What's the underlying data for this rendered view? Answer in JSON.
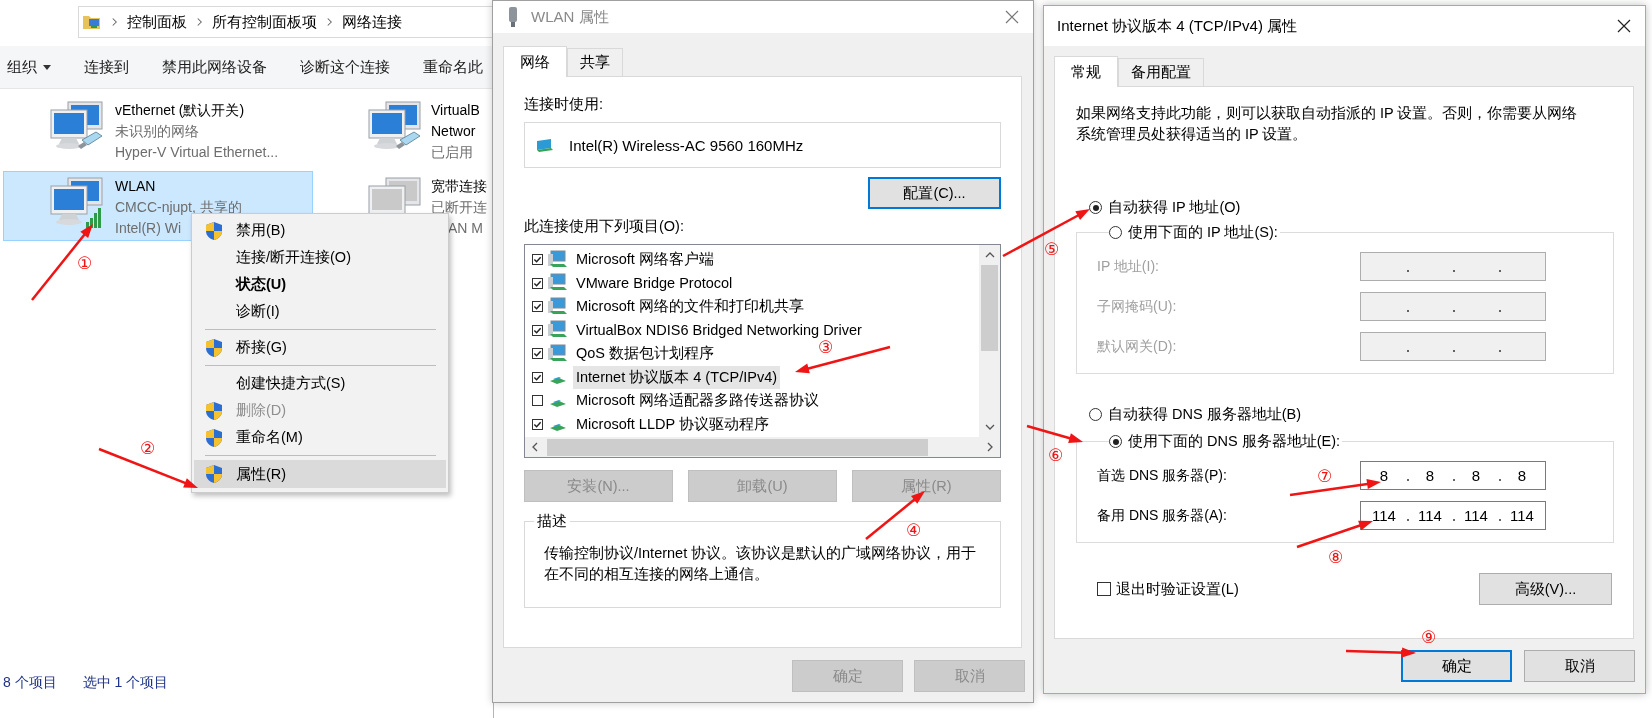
{
  "explorer": {
    "breadcrumb": [
      "控制面板",
      "所有控制面板项",
      "网络连接"
    ],
    "toolbar": [
      {
        "label": "组织",
        "dropdown": true
      },
      {
        "label": "连接到",
        "dropdown": false
      },
      {
        "label": "禁用此网络设备",
        "dropdown": false
      },
      {
        "label": "诊断这个连接",
        "dropdown": false
      },
      {
        "label": "重命名此",
        "dropdown": false
      }
    ],
    "connections": [
      {
        "kind": "ethernet",
        "name": [
          "vEthernet (默认开关)"
        ],
        "details": [
          "未识别的网络",
          "Hyper-V Virtual Ethernet..."
        ],
        "selected": false
      },
      {
        "kind": "ethernet",
        "name": [
          "VirtualB",
          "Networ"
        ],
        "details": [
          "已启用"
        ],
        "selected": false
      },
      {
        "kind": "wifi",
        "name": [
          "WLAN"
        ],
        "details": [
          "CMCC-njupt, 共享的",
          "Intel(R) Wi"
        ],
        "selected": true
      },
      {
        "kind": "disconnected",
        "name": [
          "宽带连接"
        ],
        "details": [
          "已断开连",
          "AN M"
        ],
        "selected": false
      }
    ],
    "status_bar": [
      "8 个项目",
      "选中 1 个项目"
    ]
  },
  "context_menu": {
    "items": [
      {
        "kind": "item",
        "label": "禁用(B)",
        "shield": true,
        "bold": false,
        "disabled": false,
        "selected": false
      },
      {
        "kind": "item",
        "label": "连接/断开连接(O)",
        "shield": false,
        "bold": false,
        "disabled": false,
        "selected": false
      },
      {
        "kind": "item",
        "label": "状态(U)",
        "shield": false,
        "bold": true,
        "disabled": false,
        "selected": false
      },
      {
        "kind": "item",
        "label": "诊断(I)",
        "shield": false,
        "bold": false,
        "disabled": false,
        "selected": false
      },
      {
        "kind": "separator"
      },
      {
        "kind": "item",
        "label": "桥接(G)",
        "shield": true,
        "bold": false,
        "disabled": false,
        "selected": false
      },
      {
        "kind": "separator"
      },
      {
        "kind": "item",
        "label": "创建快捷方式(S)",
        "shield": false,
        "bold": false,
        "disabled": false,
        "selected": false
      },
      {
        "kind": "item",
        "label": "删除(D)",
        "shield": true,
        "bold": false,
        "disabled": true,
        "selected": false
      },
      {
        "kind": "item",
        "label": "重命名(M)",
        "shield": true,
        "bold": false,
        "disabled": false,
        "selected": false
      },
      {
        "kind": "separator"
      },
      {
        "kind": "item",
        "label": "属性(R)",
        "shield": true,
        "bold": false,
        "disabled": false,
        "selected": true
      }
    ]
  },
  "wlan_dialog": {
    "title": "WLAN 属性",
    "tabs": [
      {
        "label": "网络",
        "selected": true
      },
      {
        "label": "共享",
        "selected": false
      }
    ],
    "connect_using_label": "连接时使用:",
    "adapter": "Intel(R) Wireless-AC 9560 160MHz",
    "configure_button": "配置(C)...",
    "items_label": "此连接使用下列项目(O):",
    "items": [
      {
        "kind": "service",
        "label": "Microsoft 网络客户端",
        "checked": true,
        "selected": false
      },
      {
        "kind": "service",
        "label": "VMware Bridge Protocol",
        "checked": true,
        "selected": false
      },
      {
        "kind": "service",
        "label": "Microsoft 网络的文件和打印机共享",
        "checked": true,
        "selected": false
      },
      {
        "kind": "service",
        "label": "VirtualBox NDIS6 Bridged Networking Driver",
        "checked": true,
        "selected": false
      },
      {
        "kind": "service",
        "label": "QoS 数据包计划程序",
        "checked": true,
        "selected": false
      },
      {
        "kind": "protocol",
        "label": "Internet 协议版本 4 (TCP/IPv4)",
        "checked": true,
        "selected": true
      },
      {
        "kind": "protocol",
        "label": "Microsoft 网络适配器多路传送器协议",
        "checked": false,
        "selected": false
      },
      {
        "kind": "protocol",
        "label": "Microsoft LLDP 协议驱动程序",
        "checked": true,
        "selected": false
      }
    ],
    "buttons": [
      {
        "label": "安装(N)...",
        "disabled": true
      },
      {
        "label": "卸载(U)",
        "disabled": true
      },
      {
        "label": "属性(R)",
        "disabled": true
      }
    ],
    "description_title": "描述",
    "description": "传输控制协议/Internet 协议。该协议是默认的广域网络协议，用于在不同的相互连接的网络上通信。",
    "footer_buttons": [
      {
        "label": "确定",
        "disabled": true
      },
      {
        "label": "取消",
        "disabled": true
      }
    ]
  },
  "ipv4_dialog": {
    "title": "Internet 协议版本 4 (TCP/IPv4) 属性",
    "tabs": [
      {
        "label": "常规",
        "selected": true
      },
      {
        "label": "备用配置",
        "selected": false
      }
    ],
    "intro": "如果网络支持此功能，则可以获取自动指派的 IP 设置。否则，你需要从网络系统管理员处获得适当的 IP 设置。",
    "ip_mode": [
      {
        "label": "自动获得 IP 地址(O)",
        "selected": true
      },
      {
        "label": "使用下面的 IP 地址(S):",
        "selected": false
      }
    ],
    "ip_fields": [
      {
        "label": "IP 地址(I):",
        "disabled": true
      },
      {
        "label": "子网掩码(U):",
        "disabled": true
      },
      {
        "label": "默认网关(D):",
        "disabled": true
      }
    ],
    "dns_mode": [
      {
        "label": "自动获得 DNS 服务器地址(B)",
        "selected": false
      },
      {
        "label": "使用下面的 DNS 服务器地址(E):",
        "selected": true
      }
    ],
    "dns_fields": [
      {
        "label": "首选 DNS 服务器(P):",
        "disabled": false,
        "octets": [
          "8",
          "8",
          "8",
          "8"
        ]
      },
      {
        "label": "备用 DNS 服务器(A):",
        "disabled": false,
        "octets": [
          "114",
          "114",
          "114",
          "114"
        ]
      }
    ],
    "validate_on_exit": {
      "label": "退出时验证设置(L)",
      "checked": false
    },
    "advanced_button": "高级(V)...",
    "buttons": [
      {
        "label": "确定",
        "default": true
      },
      {
        "label": "取消",
        "default": false
      }
    ]
  },
  "annotations": [
    {
      "label": "①"
    },
    {
      "label": "②"
    },
    {
      "label": "③"
    },
    {
      "label": "④"
    },
    {
      "label": "⑤"
    },
    {
      "label": "⑥"
    },
    {
      "label": "⑦"
    },
    {
      "label": "⑧"
    },
    {
      "label": "⑨"
    }
  ]
}
